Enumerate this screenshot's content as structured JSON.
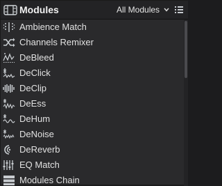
{
  "header": {
    "title": "Modules",
    "title_icon": "modules-icon",
    "filter_label": "All Modules",
    "filter_icon": "chevron-down-icon",
    "menu_icon": "list-menu-icon"
  },
  "colors": {
    "panel_bg": "#2a2a2c",
    "header_bg": "#232325",
    "text": "#e2e2e2",
    "icon": "#c8ccd0"
  },
  "modules": [
    {
      "label": "Ambience Match",
      "icon": "ambience-match-icon"
    },
    {
      "label": "Channels Remixer",
      "icon": "shuffle-icon"
    },
    {
      "label": "DeBleed",
      "icon": "debleed-icon"
    },
    {
      "label": "DeClick",
      "icon": "declick-icon"
    },
    {
      "label": "DeClip",
      "icon": "declip-icon"
    },
    {
      "label": "DeEss",
      "icon": "deess-icon"
    },
    {
      "label": "DeHum",
      "icon": "dehum-icon"
    },
    {
      "label": "DeNoise",
      "icon": "denoise-icon"
    },
    {
      "label": "DeReverb",
      "icon": "dereverb-icon"
    },
    {
      "label": "EQ Match",
      "icon": "eq-match-icon"
    },
    {
      "label": "Modules Chain",
      "icon": "modules-chain-icon"
    }
  ]
}
